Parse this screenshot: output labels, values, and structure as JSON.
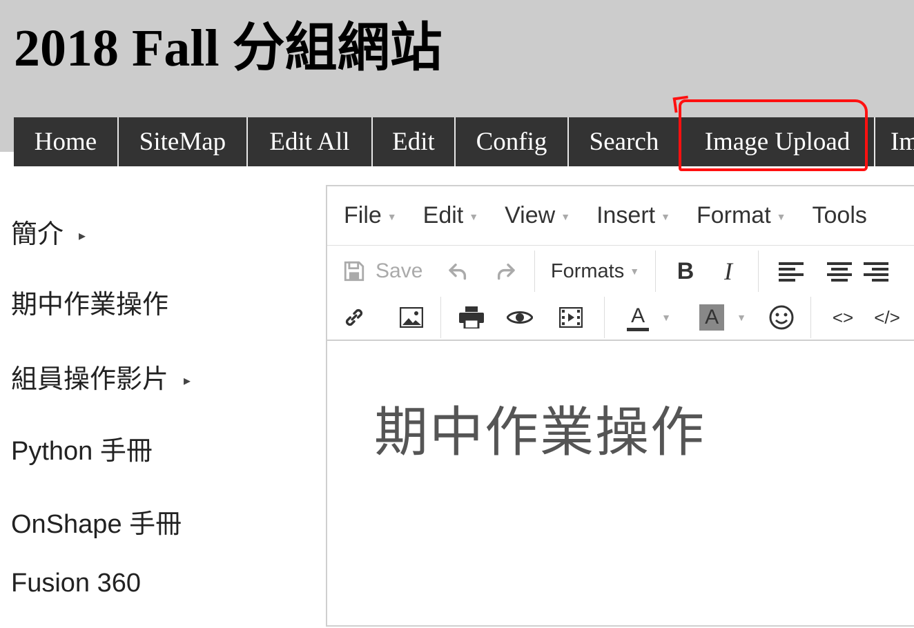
{
  "site": {
    "title": "2018 Fall 分組網站"
  },
  "nav": {
    "items": [
      {
        "label": "Home"
      },
      {
        "label": "SiteMap"
      },
      {
        "label": "Edit All"
      },
      {
        "label": "Edit"
      },
      {
        "label": "Config"
      },
      {
        "label": "Search"
      },
      {
        "label": "Image Upload"
      },
      {
        "label": "Im"
      }
    ],
    "highlight_color": "#ff1010"
  },
  "sidebar": {
    "items": [
      {
        "label": "簡介",
        "has_submenu": true
      },
      {
        "label": "期中作業操作",
        "has_submenu": false
      },
      {
        "label": "組員操作影片",
        "has_submenu": true
      },
      {
        "label": "Python 手冊",
        "has_submenu": false
      },
      {
        "label": "OnShape 手冊",
        "has_submenu": false
      },
      {
        "label": "Fusion 360",
        "has_submenu": false
      }
    ]
  },
  "editor": {
    "menu": [
      {
        "label": "File"
      },
      {
        "label": "Edit"
      },
      {
        "label": "View"
      },
      {
        "label": "Insert"
      },
      {
        "label": "Format"
      },
      {
        "label": "Tools"
      }
    ],
    "toolbar": {
      "save_label": "Save",
      "formats_label": "Formats",
      "bold_label": "B",
      "italic_label": "I",
      "text_color_label": "A",
      "bg_color_label": "A",
      "source_label": "<>",
      "code_label": "</>"
    },
    "content": {
      "heading": "期中作業操作"
    }
  }
}
